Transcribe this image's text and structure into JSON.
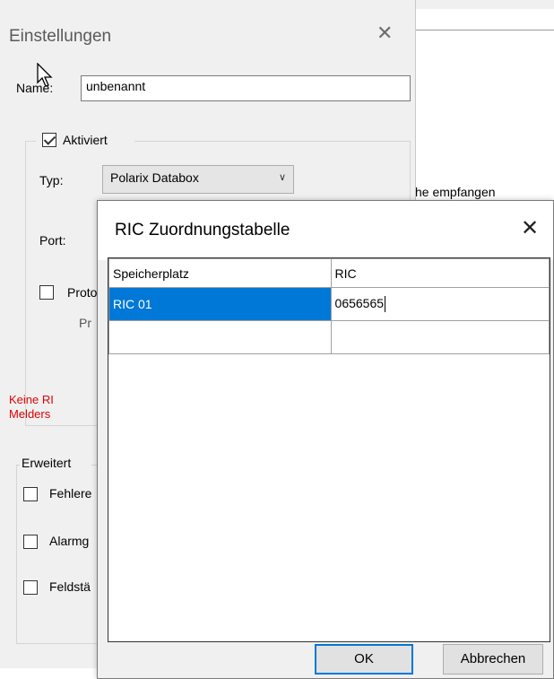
{
  "background_window": {
    "text_fragment": "he empfangen"
  },
  "settings": {
    "title": "Einstellungen",
    "close_glyph": "✕",
    "name_label": "Name:",
    "name_value": "unbenannt",
    "aktiviert_label": "Aktiviert",
    "aktiviert_checked": true,
    "typ_label": "Typ:",
    "typ_value": "Polarix Databox",
    "port_label": "Port:",
    "proto_label": "Proto",
    "pr_label": "Pr",
    "warning_line1": "Keine RI",
    "warning_line2": "Melders",
    "erweitert_label": "Erweitert",
    "options": [
      "Fehlere",
      "Alarmg",
      "Feldstä"
    ]
  },
  "ric_dialog": {
    "title": "RIC Zuordnungstabelle",
    "close_glyph": "✕",
    "columns": [
      "Speicherplatz",
      "RIC"
    ],
    "rows": [
      {
        "speicherplatz": "RIC 01",
        "ric": "0656565"
      },
      {
        "speicherplatz": "",
        "ric": ""
      }
    ],
    "ok_label": "OK",
    "cancel_label": "Abbrechen"
  },
  "colors": {
    "selection": "#0078d7",
    "warning": "#e00000",
    "dialog_bg": "#f0f0f0"
  }
}
